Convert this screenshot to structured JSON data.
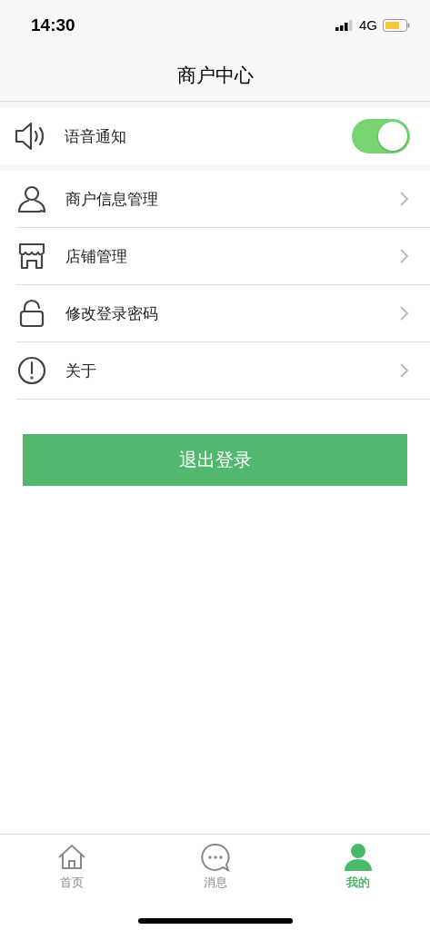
{
  "status_bar": {
    "time": "14:30",
    "network": "4G"
  },
  "nav": {
    "title": "商户中心"
  },
  "voice_notice": {
    "label": "语音通知",
    "on": true
  },
  "menu": [
    {
      "label": "商户信息管理"
    },
    {
      "label": "店铺管理"
    },
    {
      "label": "修改登录密码"
    },
    {
      "label": "关于"
    }
  ],
  "logout_button": "退出登录",
  "tabs": [
    {
      "label": "首页",
      "selected": false
    },
    {
      "label": "消息",
      "selected": false
    },
    {
      "label": "我的",
      "selected": true
    }
  ]
}
